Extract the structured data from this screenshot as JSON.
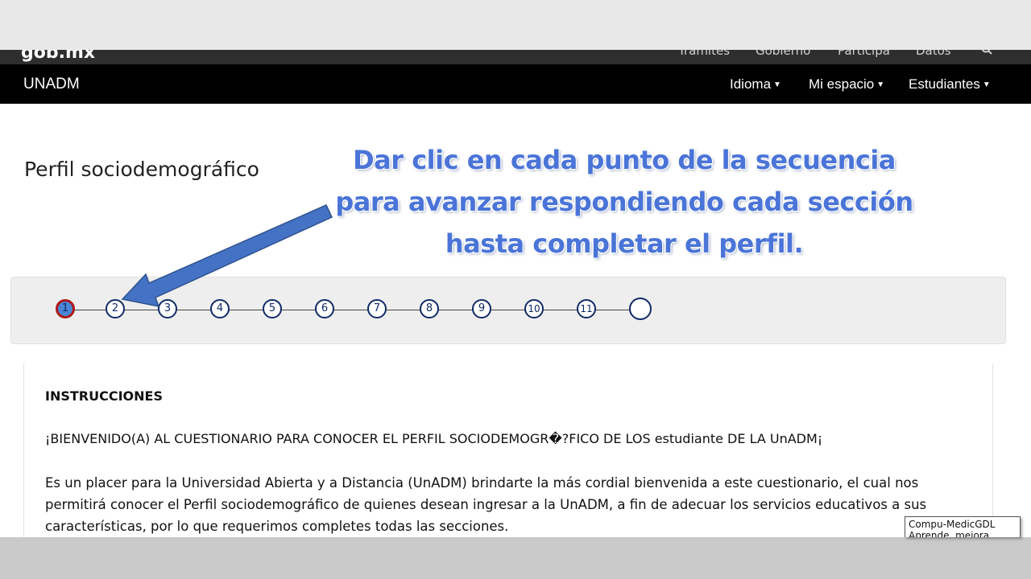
{
  "gob_header": {
    "logo": "gob.mx",
    "links": [
      "Trámites",
      "Gobierno",
      "Participa",
      "Datos"
    ],
    "search_icon": "search-icon"
  },
  "navbar": {
    "brand": "UNADM",
    "menus": [
      {
        "label": "Idioma"
      },
      {
        "label": "Mi espacio"
      },
      {
        "label": "Estudiantes"
      }
    ]
  },
  "page": {
    "title": "Perfil sociodemográfico"
  },
  "callout": {
    "lines": [
      "Dar clic en cada punto de la secuencia",
      "para avanzar respondiendo cada sección",
      "hasta completar el perfil."
    ],
    "color": "#4a74d8"
  },
  "stepper": {
    "steps": [
      "1",
      "2",
      "3",
      "4",
      "5",
      "6",
      "7",
      "8",
      "9",
      "10",
      "11",
      ""
    ],
    "active_step": "1",
    "active_fill": "#4a86d6",
    "active_border": "#b01818",
    "step_color": "#0f2a66"
  },
  "instructions": {
    "heading": "INSTRUCCIONES",
    "welcome": "¡BIENVENIDO(A) AL CUESTIONARIO PARA CONOCER EL PERFIL SOCIODEMOGR�?FICO DE LOS estudiante DE LA UnADM¡",
    "lines": [
      "Es un placer para la Universidad Abierta y a Distancia (UnADM) brindarte la más cordial bienvenida a este cuestionario, el cual nos",
      "permitirá conocer el Perfil sociodemográfico de quienes desean ingresar a la UnADM, a fin de adecuar los servicios educativos a sus",
      "características, por lo que requerimos completes todas las secciones."
    ]
  },
  "watermark": {
    "line1": "Compu-MedicGDL",
    "line2": "Aprende, mejora, crece"
  }
}
